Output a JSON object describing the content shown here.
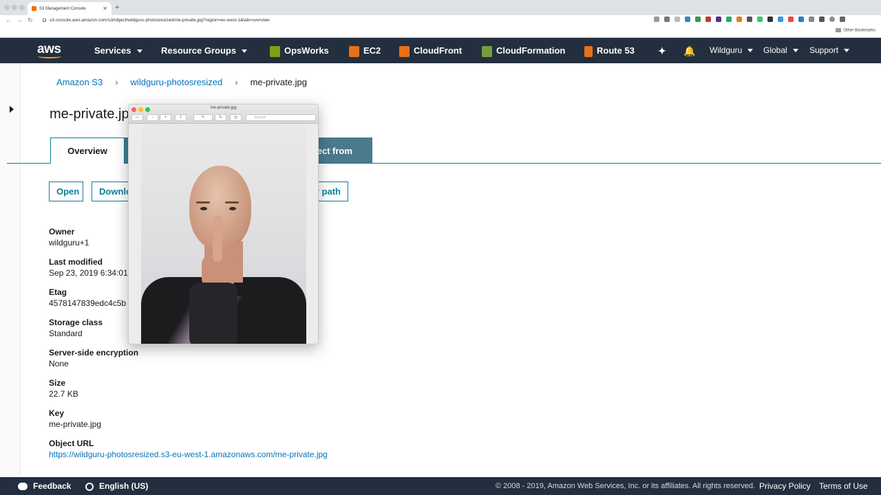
{
  "browser": {
    "tab_title": "S3 Management Console",
    "url": "s3.console.aws.amazon.com/s3/object/wildguru-photosresized/me-private.jpg?region=eu-west-1&tab=overview",
    "bookmarks_label": "Other Bookmarks"
  },
  "nav": {
    "logo": "aws",
    "services": "Services",
    "resource_groups": "Resource Groups",
    "opsworks": "OpsWorks",
    "ec2": "EC2",
    "cloudfront": "CloudFront",
    "cloudformation": "CloudFormation",
    "route53": "Route 53",
    "account": "Wildguru",
    "region": "Global",
    "support": "Support"
  },
  "breadcrumb": {
    "root": "Amazon S3",
    "bucket": "wildguru-photosresized",
    "object": "me-private.jpg"
  },
  "page": {
    "title": "me-private.jp",
    "tab_overview": "Overview",
    "tab_partial": "lect from"
  },
  "actions": {
    "open": "Open",
    "download": "Downlo",
    "copy_path": "y path"
  },
  "properties": {
    "owner_label": "Owner",
    "owner_value": "wildguru+1",
    "modified_label": "Last modified",
    "modified_value": "Sep 23, 2019 6:34:01",
    "etag_label": "Etag",
    "etag_value": "4578147839edc4c5b",
    "storage_label": "Storage class",
    "storage_value": "Standard",
    "encryption_label": "Server-side encryption",
    "encryption_value": "None",
    "size_label": "Size",
    "size_value": "22.7 KB",
    "key_label": "Key",
    "key_value": "me-private.jpg",
    "url_label": "Object URL",
    "url_value": "https://wildguru-photosresized.s3-eu-west-1.amazonaws.com/me-private.jpg"
  },
  "preview": {
    "window_title": "me-private.jpg",
    "search_placeholder": "Search"
  },
  "footer": {
    "feedback": "Feedback",
    "language": "English (US)",
    "copyright": "© 2008 - 2019, Amazon Web Services, Inc. or its affiliates. All rights reserved.",
    "privacy": "Privacy Policy",
    "terms": "Terms of Use"
  },
  "colors": {
    "nav_bg": "#232f3e",
    "link": "#0073bb",
    "teal": "#0a7d9a",
    "accent": "#ff9900"
  }
}
